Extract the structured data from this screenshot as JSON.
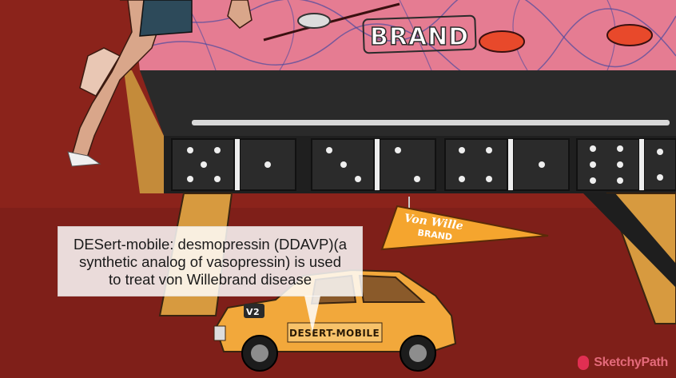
{
  "caption": {
    "line1": "DESert-mobile: desmopressin (DDAVP)(a",
    "line2": "synthetic analog of vasopressin) is used",
    "line3": "to treat von Willebrand disease"
  },
  "table_label": "BRAND",
  "pennant": {
    "line1": "Von Wille",
    "line2": "BRAND"
  },
  "car": {
    "badge": "V2",
    "label": "DESERT-MOBILE"
  },
  "watermark": "SketchyPath",
  "colors": {
    "background": "#8e241c",
    "table_top": "#e57c92",
    "table_body": "#242424",
    "car": "#f2a83b",
    "pennant": "#f5a52e"
  }
}
